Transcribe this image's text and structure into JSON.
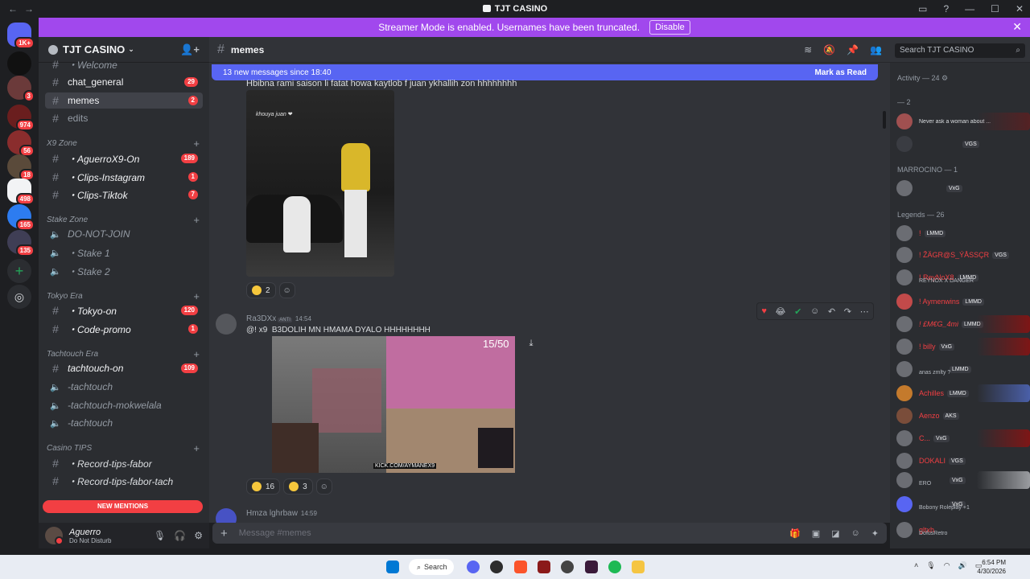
{
  "window": {
    "title": "TJT CASINO",
    "back_icon": "←",
    "forward_icon": "→"
  },
  "banner": {
    "text": "Streamer Mode is enabled. Usernames have been truncated.",
    "button": "Disable"
  },
  "servers": [
    {
      "badge": "1K+"
    },
    {
      "badge": ""
    },
    {
      "badge": "3"
    },
    {
      "badge": "974"
    },
    {
      "badge": "56"
    },
    {
      "badge": "18"
    },
    {
      "badge": "498"
    },
    {
      "badge": "165"
    },
    {
      "badge": "135"
    }
  ],
  "guild": {
    "name": "TJT CASINO"
  },
  "channels": {
    "welcome": "・Welcome",
    "chat_general": "chat_general",
    "chat_general_count": "29",
    "memes": "memes",
    "memes_count": "2",
    "edits": "edits",
    "cat_x9": "X9 Zone",
    "aguerro": "・AguerroX9-On",
    "aguerro_count": "189",
    "clips_ig": "・Clips-Instagram",
    "clips_ig_count": "1",
    "clips_tt": "・Clips-Tiktok",
    "clips_tt_count": "7",
    "cat_stake": "Stake Zone",
    "do_not_join": "DO-NOT-JOIN",
    "stake1": "・Stake 1",
    "stake2": "・Stake 2",
    "cat_tokyo": "Tokyo Era",
    "tokyo_on": "・Tokyo-on",
    "tokyo_on_count": "120",
    "code_promo": "・Code-promo",
    "code_promo_count": "1",
    "cat_tachtouch": "Tachtouch Era",
    "tachtouch_on": "tachtouch-on",
    "tachtouch_on_count": "109",
    "tachtouch_v1": "-tachtouch",
    "tachtouch_mok": "-tachtouch-mokwelala",
    "tachtouch_v2": "-tachtouch",
    "cat_casino": "Casino TIPS",
    "record_fabor": "・Record-tips-fabor",
    "record_fabor_tach": "・Record-tips-fabor-tach"
  },
  "new_mentions": "NEW MENTIONS",
  "user": {
    "name": "Aguerro",
    "status": "Do Not Disturb"
  },
  "chat": {
    "channel": "memes",
    "new_messages": "13 new messages since 18:40",
    "mark_read": "Mark as Read",
    "first_line": "Hbibna rami saison li fatat howa kaytlob f juan ykhallih zon hhhhhhhh",
    "img1_caption": "khouya juan ❤",
    "reaction1_count": "2",
    "msg2_author": "Ra3DXx",
    "msg2_tag": "ANTI",
    "msg2_time": "14:54",
    "msg2_text": "B3DOLIH MN HMAMA DYALO HHHHHHHH",
    "msg2_prefix": "@! x9",
    "video_counter": "15/50",
    "video_overlay": "KICK.COM/AYMANEX9",
    "react_laugh_count": "16",
    "react_rofl_count": "3",
    "msg3_author": "Hmza lghrbaw",
    "msg3_time": "14:59",
    "composer_placeholder": "Message #memes"
  },
  "search": {
    "placeholder": "Search TJT CASINO"
  },
  "members": {
    "activity": "Activity — 24",
    "sec_online": "— 2",
    "m1_status": "Never ask a woman about ...",
    "m2_tag": "VGS",
    "marrocino": "MARROCINO — 1",
    "m3_tag": "VxG",
    "legends": "Legends — 26",
    "rows": [
      {
        "name": "! ",
        "tag": "LMMD",
        "status": ""
      },
      {
        "name": "! ŽÄGR@S_ỶÅSSÇR",
        "tag": "VGS",
        "status": ""
      },
      {
        "name": "! ReyNoX8",
        "tag": "LMMD",
        "status": "REYNOX X DANGER"
      },
      {
        "name": "! Aymenwins",
        "tag": "LMMD",
        "status": ""
      },
      {
        "name": "! £M€G_4mi",
        "tag": "LMMD",
        "status": ""
      },
      {
        "name": "! billy",
        "tag": "VxG",
        "status": ""
      },
      {
        "name": "",
        "tag": "LMMD",
        "status": "anas zmlty ?"
      },
      {
        "name": "Achilles",
        "tag": "LMMD",
        "status": ""
      },
      {
        "name": "Aenzo",
        "tag": "AKS",
        "status": ""
      },
      {
        "name": "C...",
        "tag": "VxG",
        "status": ""
      },
      {
        "name": "DOKALI",
        "tag": "VGS",
        "status": ""
      },
      {
        "name": "",
        "tag": "VxG",
        "status": "ERO"
      },
      {
        "name": "",
        "tag": "VxG",
        "status": "Bobony Roleplay +1"
      },
      {
        "name": "gltxh",
        "tag": "",
        "status": "DofusRetro"
      }
    ]
  },
  "taskbar": {
    "search": "Search",
    "time": "6:54 PM",
    "date": "4/30/2026"
  }
}
